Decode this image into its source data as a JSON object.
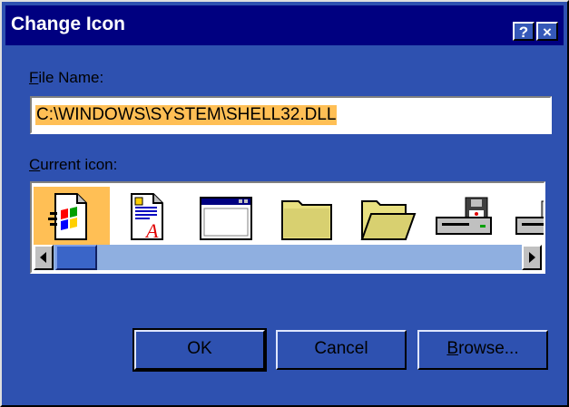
{
  "window": {
    "title": "Change Icon",
    "help_label": "?",
    "close_label": "×"
  },
  "file_name": {
    "label_underline": "F",
    "label_rest": "ile Name:",
    "value": "C:\\WINDOWS\\SYSTEM\\SHELL32.DLL"
  },
  "current_icon": {
    "label_underline": "C",
    "label_rest": "urrent icon:",
    "icons": [
      "windows-doc-icon",
      "wordpad-doc-icon",
      "window-icon",
      "folder-closed-icon",
      "folder-open-icon",
      "floppy-drive-icon",
      "drive-icon"
    ]
  },
  "buttons": {
    "ok": "OK",
    "cancel": "Cancel",
    "browse_underline": "B",
    "browse_rest": "rowse..."
  },
  "colors": {
    "dialog_bg": "#2e51b0",
    "titlebar": "#000080",
    "selection": "#ffbf55",
    "scroll_track": "#8fafe0"
  }
}
